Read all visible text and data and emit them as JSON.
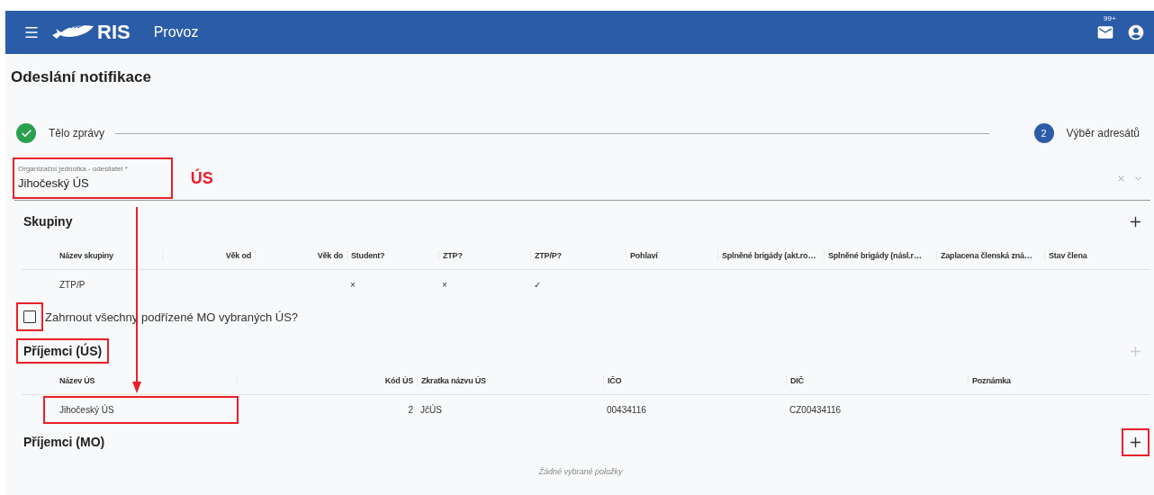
{
  "app_bar": {
    "logo_text": "RIS",
    "section": "Provoz",
    "mail_badge": "99+"
  },
  "title": "Odeslání notifikace",
  "stepper": [
    {
      "label": "Tělo zprávy",
      "done": true
    },
    {
      "label": "Výběr adresátů",
      "number": "2",
      "done": false
    }
  ],
  "sender_field": {
    "label": "Organizační jednotka - odesilatel *",
    "value": "Jihočeský ÚS",
    "marked": true,
    "annotation": "ÚS"
  },
  "groups": {
    "title": "Skupiny",
    "add": {
      "disabled": false,
      "marked": false
    },
    "columns": [
      "Název skupiny",
      "Věk od",
      "Věk do",
      "Student?",
      "ZTP?",
      "ZTP/P?",
      "Pohlaví",
      "Splněné brigády (akt.ro…",
      "Splněné brigády (násl.r…",
      "Zaplacena členská zná…",
      "Stav člena"
    ],
    "rows": [
      {
        "cells": [
          "ZTP/P",
          "",
          "",
          "×",
          "×",
          "✓",
          "",
          "",
          "",
          "",
          ""
        ],
        "name_marked": false
      }
    ]
  },
  "include_checkbox": {
    "label": "Zahrnout všechny podřízené MO vybraných ÚS?",
    "checked": false,
    "marked": true
  },
  "recipients_us": {
    "title": "Příjemci (ÚS)",
    "title_marked": true,
    "add": {
      "disabled": true,
      "marked": false
    },
    "columns": [
      "Název ÚS",
      "Kód ÚS",
      "Zkratka názvu ÚS",
      "IČO",
      "DIČ",
      "Poznámka"
    ],
    "rows": [
      {
        "cells": [
          "Jihočeský ÚS",
          "2",
          "JčÚS",
          "00434116",
          "CZ00434116",
          ""
        ],
        "name_marked": true
      }
    ]
  },
  "recipients_mo": {
    "title": "Příjemci (MO)",
    "add": {
      "disabled": false,
      "marked": true
    },
    "empty_text": "Žádné vybrané položky"
  },
  "annotation_arrow": true
}
